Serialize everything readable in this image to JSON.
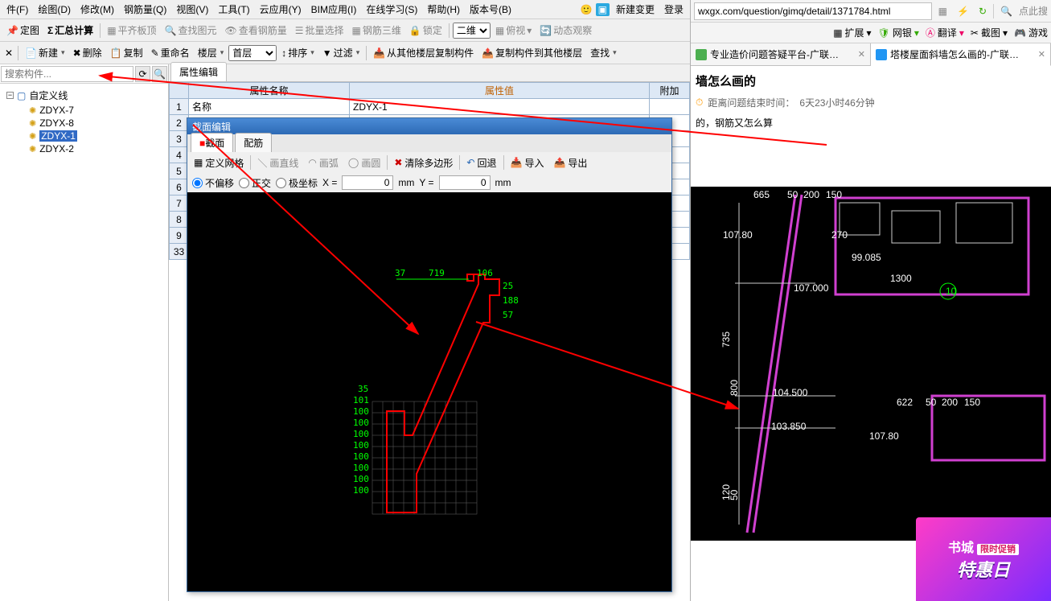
{
  "menubar": {
    "items": [
      "件(F)",
      "绘图(D)",
      "修改(M)",
      "钢筋量(Q)",
      "视图(V)",
      "工具(T)",
      "云应用(Y)",
      "BIM应用(I)",
      "在线学习(S)",
      "帮助(H)",
      "版本号(B)"
    ],
    "newchange": "新建变更",
    "login": "登录"
  },
  "toolbar1": {
    "items": [
      "定图",
      "汇总计算",
      "平齐板顶",
      "查找图元",
      "查看钢筋量",
      "批量选择",
      "钢筋三维",
      "锁定"
    ],
    "sel3d": "二维",
    "sel_view": "俯视",
    "dyn": "动态观察"
  },
  "toolbar2": {
    "new": "新建",
    "del": "删除",
    "copy": "复制",
    "rename": "重命名",
    "floor": "楼层",
    "floor_sel": "首层",
    "sort": "排序",
    "filter": "过滤",
    "copyfrom": "从其他楼层复制构件",
    "copyto": "复制构件到其他楼层",
    "find": "查找"
  },
  "sidebar": {
    "search_ph": "搜索构件...",
    "folder": "自定义线",
    "nodes": [
      "ZDYX-7",
      "ZDYX-8",
      "ZDYX-1",
      "ZDYX-2"
    ],
    "sel_index": 2
  },
  "center": {
    "tab": "属性编辑",
    "headers": [
      "属性名称",
      "属性值",
      "附加"
    ],
    "rows": [
      {
        "n": "1",
        "name": "名称",
        "val": "ZDYX-1"
      },
      {
        "n": "2",
        "name": "",
        "val": ""
      },
      {
        "n": "3",
        "name": "",
        "val": ""
      },
      {
        "n": "4",
        "name": "",
        "val": ""
      },
      {
        "n": "5",
        "name": "",
        "val": ""
      },
      {
        "n": "6",
        "name": "",
        "val": ""
      },
      {
        "n": "7",
        "name": "",
        "val": ""
      },
      {
        "n": "8",
        "name": "",
        "val": ""
      },
      {
        "n": "9",
        "name": "",
        "val": ""
      },
      {
        "n": "33",
        "name": "",
        "val": ""
      }
    ]
  },
  "dialog": {
    "title": "截面编辑",
    "tab1": "截面",
    "tab2": "配筋",
    "tool": {
      "grid": "定义网格",
      "line": "画直线",
      "arc": "画弧",
      "circle": "画圆",
      "clear": "清除多边形",
      "undo": "回退",
      "import": "导入",
      "export": "导出"
    },
    "coord": {
      "opt1": "不偏移",
      "opt2": "正交",
      "opt3": "极坐标",
      "xl": "X =",
      "yl": "Y =",
      "x": "0",
      "y": "0",
      "mm": "mm"
    },
    "dims_top": [
      "37",
      "719",
      "106",
      "25",
      "188",
      "57"
    ],
    "dims_left": [
      "35",
      "101",
      "100",
      "100",
      "100",
      "100",
      "100",
      "100",
      "100",
      "100"
    ]
  },
  "browser": {
    "url": "wxgx.com/question/gimq/detail/1371784.html",
    "search_ph": "点此搜",
    "ext": {
      "expand": "扩展",
      "bank": "网银",
      "trans": "翻译",
      "shot": "截图",
      "game": "游戏"
    },
    "tabs": [
      {
        "label": "专业造价问题答疑平台-广联…"
      },
      {
        "label": "塔楼屋面斜墙怎么画的-广联…"
      }
    ],
    "active_tab": 1,
    "question": {
      "title_frag": "墙怎么画的",
      "countdown_lbl": "距离问题结束时间：",
      "countdown_val": "6天23小时46分钟",
      "body_frag": "的，钢筋又怎么算"
    },
    "cad_dims": [
      "665",
      "50",
      "200",
      "150",
      "107.80",
      "270",
      "99.085",
      "1300",
      "107.000",
      "104.500",
      "103.850",
      "622",
      "50",
      "200",
      "150",
      "107.80",
      "735",
      "800",
      "120",
      "50"
    ],
    "promo": {
      "l1": "书城",
      "tag": "限时促销",
      "l2": "特惠日"
    }
  }
}
